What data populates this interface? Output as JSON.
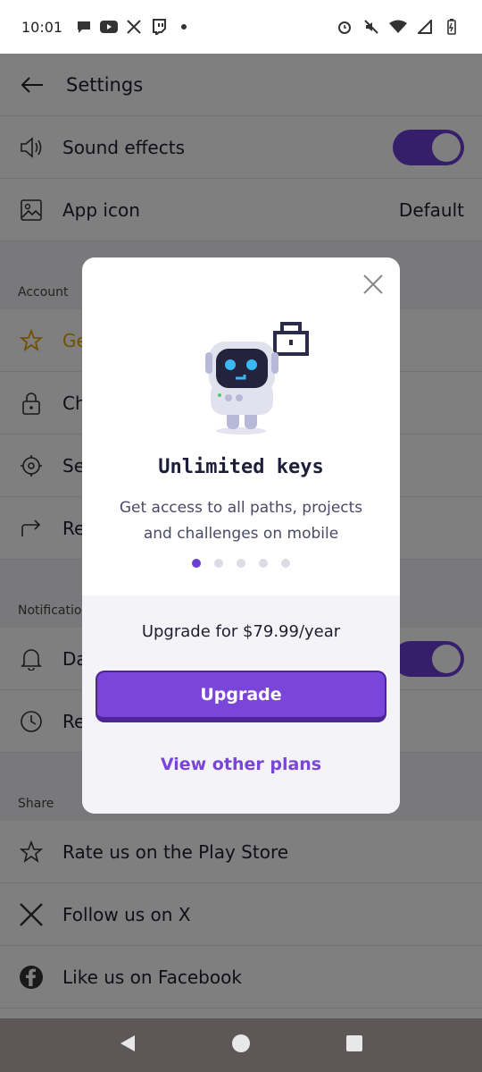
{
  "status_bar": {
    "time": "10:01"
  },
  "header": {
    "title": "Settings"
  },
  "settings_rows_top": [
    {
      "label": "Sound effects",
      "has_toggle": true
    },
    {
      "label": "App icon",
      "value": "Default"
    }
  ],
  "sections": {
    "account": {
      "heading": "Account",
      "items": [
        {
          "label": "Ge"
        },
        {
          "label": "Ch"
        },
        {
          "label": "Se"
        },
        {
          "label": "Re"
        }
      ]
    },
    "notifications": {
      "heading": "Notification",
      "items": [
        {
          "label": "Da"
        },
        {
          "label": "Re"
        }
      ]
    },
    "share": {
      "heading": "Share",
      "items": [
        {
          "label": "Rate us on the Play Store"
        },
        {
          "label": "Follow us on X"
        },
        {
          "label": "Like us on Facebook"
        }
      ]
    }
  },
  "modal": {
    "title": "Unlimited keys",
    "description": "Get access to all paths, projects and challenges on mobile",
    "carousel_dots": 5,
    "carousel_active": 1,
    "price_text": "Upgrade for $79.99/year",
    "upgrade_label": "Upgrade",
    "other_plans_label": "View other plans"
  },
  "colors": {
    "accent": "#7a45d9",
    "toggle_on": "#6b3fd4",
    "overlay": "rgba(0,0,0,0.5)"
  }
}
